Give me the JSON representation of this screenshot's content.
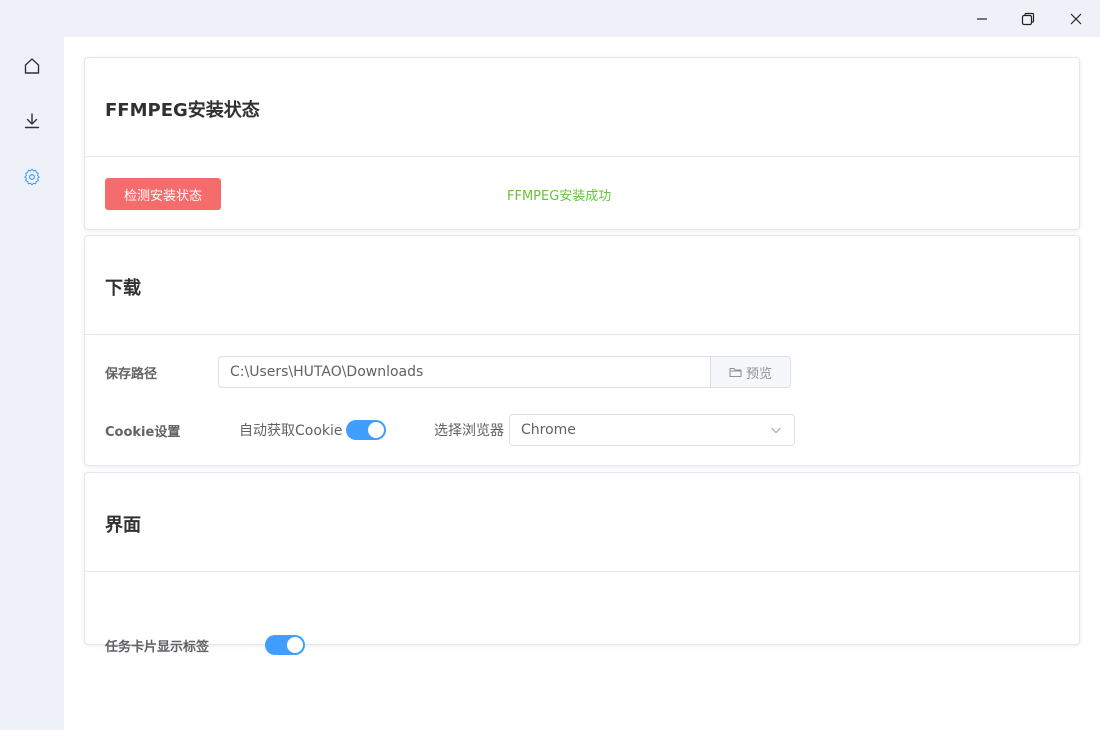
{
  "window": {
    "controls": {
      "minimize_icon": "minimize-icon",
      "maximize_icon": "restore-icon",
      "close_icon": "close-icon"
    }
  },
  "sidebar": {
    "items": [
      {
        "icon": "home-icon"
      },
      {
        "icon": "download-icon"
      },
      {
        "icon": "gear-icon",
        "active": true
      }
    ],
    "active_color": "#409eff"
  },
  "ffmpeg_card": {
    "title": "FFMPEG安装状态",
    "check_button": "检测安装状态",
    "status": "FFMPEG安装成功",
    "button_color": "#f56c6c",
    "status_color": "#67c23a"
  },
  "download_card": {
    "title": "下载",
    "save_path_label": "保存路径",
    "save_path_value": "C:\\Users\\HUTAO\\Downloads",
    "preview_button": "预览",
    "cookie_label": "Cookie设置",
    "auto_cookie_label": "自动获取Cookie",
    "auto_cookie_enabled": true,
    "browser_label": "选择浏览器",
    "browser_value": "Chrome"
  },
  "ui_card": {
    "title": "界面",
    "show_tag_label": "任务卡片显示标签",
    "show_tag_enabled": true
  },
  "switch_color": "#409eff"
}
